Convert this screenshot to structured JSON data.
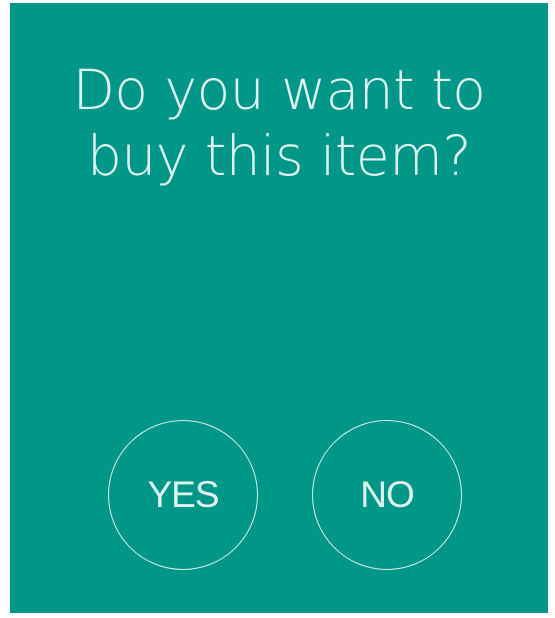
{
  "prompt": {
    "line1": "Do you want to",
    "line2": "buy this item?"
  },
  "buttons": {
    "yes_label": "YES",
    "no_label": "NO"
  },
  "colors": {
    "background": "#009688",
    "text": "#e0f2ef",
    "button_outline": "#d6eeea"
  }
}
